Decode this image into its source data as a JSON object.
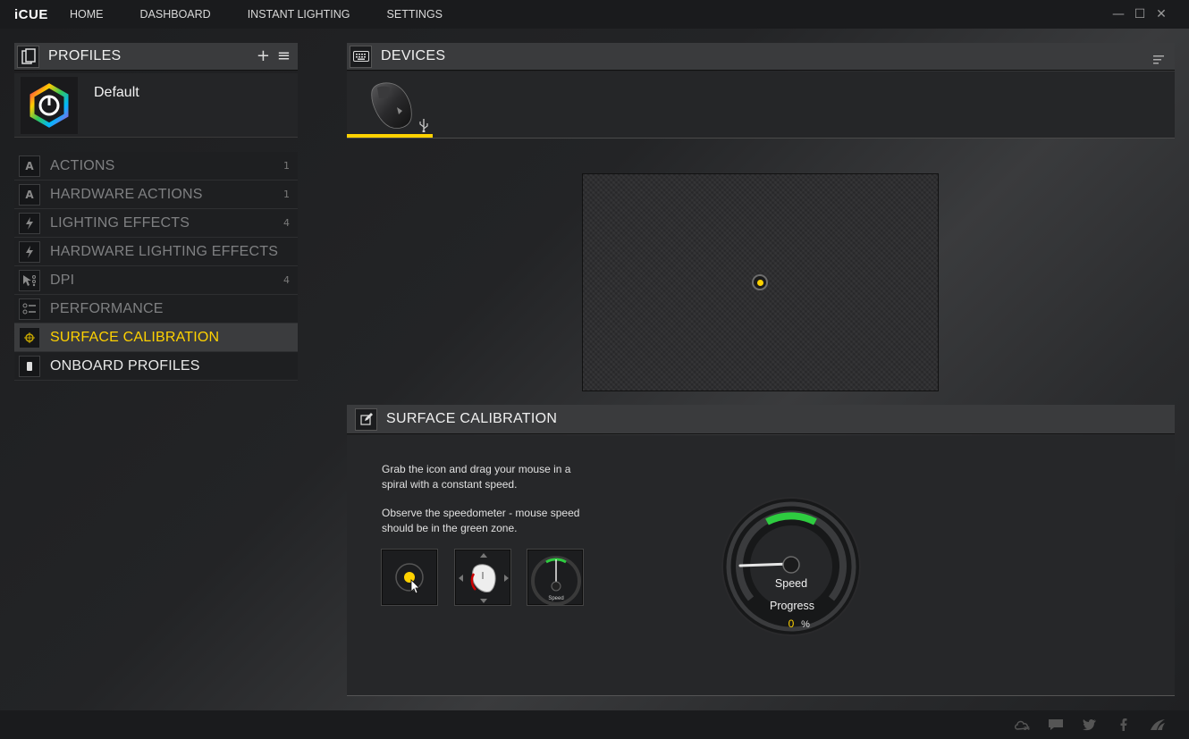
{
  "app": {
    "brand": "iCUE"
  },
  "nav": [
    {
      "label": "HOME"
    },
    {
      "label": "DASHBOARD"
    },
    {
      "label": "INSTANT LIGHTING"
    },
    {
      "label": "SETTINGS"
    }
  ],
  "window_controls": {
    "minimize": "—",
    "maximize": "☐",
    "close": "✕"
  },
  "profiles": {
    "title": "PROFILES",
    "add_label": "+",
    "menu_label": "≡",
    "current": {
      "name": "Default"
    }
  },
  "menu": [
    {
      "label": "ACTIONS",
      "count": "1",
      "icon": "a-icon"
    },
    {
      "label": "HARDWARE ACTIONS",
      "count": "1",
      "icon": "a-icon"
    },
    {
      "label": "LIGHTING EFFECTS",
      "count": "4",
      "icon": "lightning-icon"
    },
    {
      "label": "HARDWARE LIGHTING EFFECTS",
      "count": "",
      "icon": "lightning-icon"
    },
    {
      "label": "DPI",
      "count": "4",
      "icon": "dpi-icon"
    },
    {
      "label": "PERFORMANCE",
      "count": "",
      "icon": "performance-icon"
    },
    {
      "label": "SURFACE CALIBRATION",
      "count": "",
      "icon": "crosshair-icon",
      "active": true
    },
    {
      "label": "ONBOARD PROFILES",
      "count": "",
      "icon": "memory-icon"
    }
  ],
  "devices": {
    "title": "DEVICES"
  },
  "calibration": {
    "title": "SURFACE CALIBRATION",
    "instruction1": "Grab the icon and drag your mouse in a spiral with a constant speed.",
    "instruction2": "Observe the speedometer - mouse speed should be in the green zone.",
    "mini_speed_label": "Speed",
    "speed_label": "Speed",
    "progress_label": "Progress",
    "progress_value": "0",
    "progress_unit": "%"
  },
  "colors": {
    "accent": "#ffd200",
    "green_zone": "#2ecc40"
  }
}
